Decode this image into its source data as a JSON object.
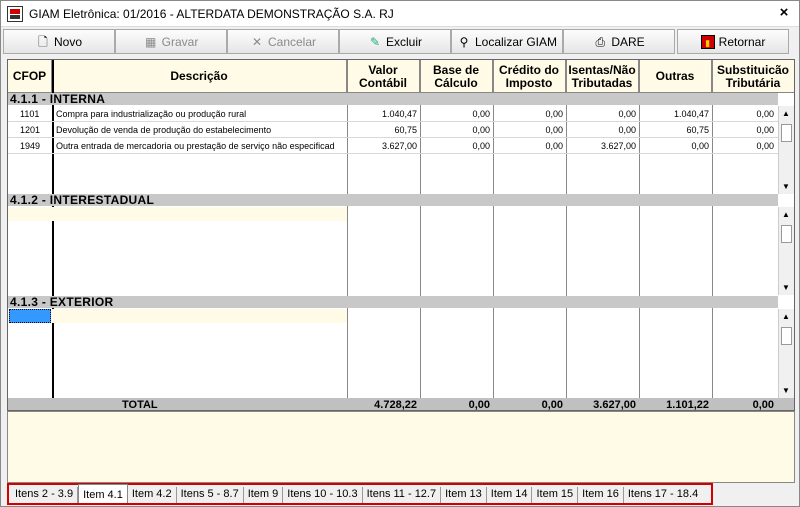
{
  "window": {
    "title": "GIAM Eletrônica: 01/2016 - ALTERDATA DEMONSTRAÇÃO S.A. RJ",
    "close_glyph": "×"
  },
  "toolbar": {
    "novo": "Novo",
    "gravar": "Gravar",
    "cancelar": "Cancelar",
    "excluir": "Excluir",
    "localizar": "Localizar GIAM",
    "dare": "DARE",
    "retornar": "Retornar"
  },
  "columns": {
    "cfop": "CFOP",
    "descricao": "Descrição",
    "valor_contabil": "Valor Contábil",
    "base_calculo": "Base de Cálculo",
    "credito_imposto": "Crédito do Imposto",
    "isentas": "Isentas/Não Tributadas",
    "outras": "Outras",
    "substituicao": "Substituicão Tributária"
  },
  "sections": {
    "interna": {
      "label": "4.1.1 - INTERNA",
      "rows": [
        {
          "cfop": "1101",
          "descricao": "Compra para industrialização ou produção rural",
          "valor_contabil": "1.040,47",
          "base_calculo": "0,00",
          "credito": "0,00",
          "isentas": "0,00",
          "outras": "1.040,47",
          "substituicao": "0,00"
        },
        {
          "cfop": "1201",
          "descricao": "Devolução de venda de produção do estabelecimento",
          "valor_contabil": "60,75",
          "base_calculo": "0,00",
          "credito": "0,00",
          "isentas": "0,00",
          "outras": "60,75",
          "substituicao": "0,00"
        },
        {
          "cfop": "1949",
          "descricao": "Outra entrada de mercadoria ou prestação de serviço não especificad",
          "valor_contabil": "3.627,00",
          "base_calculo": "0,00",
          "credito": "0,00",
          "isentas": "3.627,00",
          "outras": "0,00",
          "substituicao": "0,00"
        }
      ]
    },
    "interestadual": {
      "label": "4.1.2 - INTERESTADUAL"
    },
    "exterior": {
      "label": "4.1.3 - EXTERIOR"
    }
  },
  "total": {
    "label": "TOTAL",
    "valor_contabil": "4.728,22",
    "base_calculo": "0,00",
    "credito": "0,00",
    "isentas": "3.627,00",
    "outras": "1.101,22",
    "substituicao": "0,00"
  },
  "tabs": [
    "Itens 2 - 3.9",
    "Item 4.1",
    "Item 4.2",
    "Itens 5 - 8.7",
    "Item 9",
    "Itens 10 - 10.3",
    "Itens 11 - 12.7",
    "Item 13",
    "Item 14",
    "Item 15",
    "Item 16",
    "Itens 17 - 18.4"
  ],
  "active_tab": "Item 4.1",
  "colors": {
    "accent_highlight": "#d40000",
    "row_yellow": "#fffbe6",
    "section_gray": "#c8c8c8",
    "selection_blue": "#3399ff"
  }
}
